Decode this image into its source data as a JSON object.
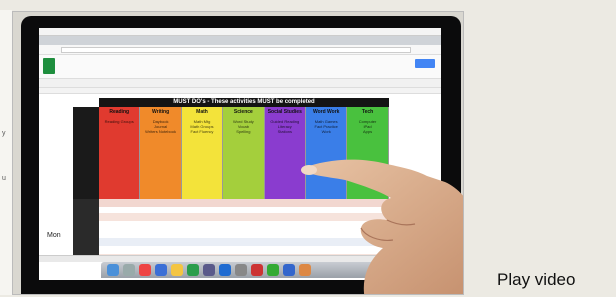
{
  "video": {
    "caption": "Play video",
    "screen": {
      "banner_text": "MUST DO's - These activities MUST be completed",
      "row_label": "Mon",
      "columns": [
        {
          "label": "Reading",
          "color": "#e03a2f",
          "body": "Reading Groups"
        },
        {
          "label": "Writing",
          "color": "#f08a2a",
          "body": "Daybook\nJournal\nWriters Notebook"
        },
        {
          "label": "Math",
          "color": "#f3e33a",
          "body": "Math Mtg\nMath Groups\nFact Fluency"
        },
        {
          "label": "Science",
          "color": "#a4cf3c",
          "body": "Word Study\nVocab\nSpelling"
        },
        {
          "label": "Social Studies",
          "color": "#8a3ccf",
          "body": "Guided Reading\nLiteracy\nStations"
        },
        {
          "label": "Word Work",
          "color": "#3a7ee8",
          "body": "Math Games\nFact Practice\nWork"
        },
        {
          "label": "Tech",
          "color": "#49c13e",
          "body": "Computer\niPad\nApps"
        }
      ]
    }
  }
}
